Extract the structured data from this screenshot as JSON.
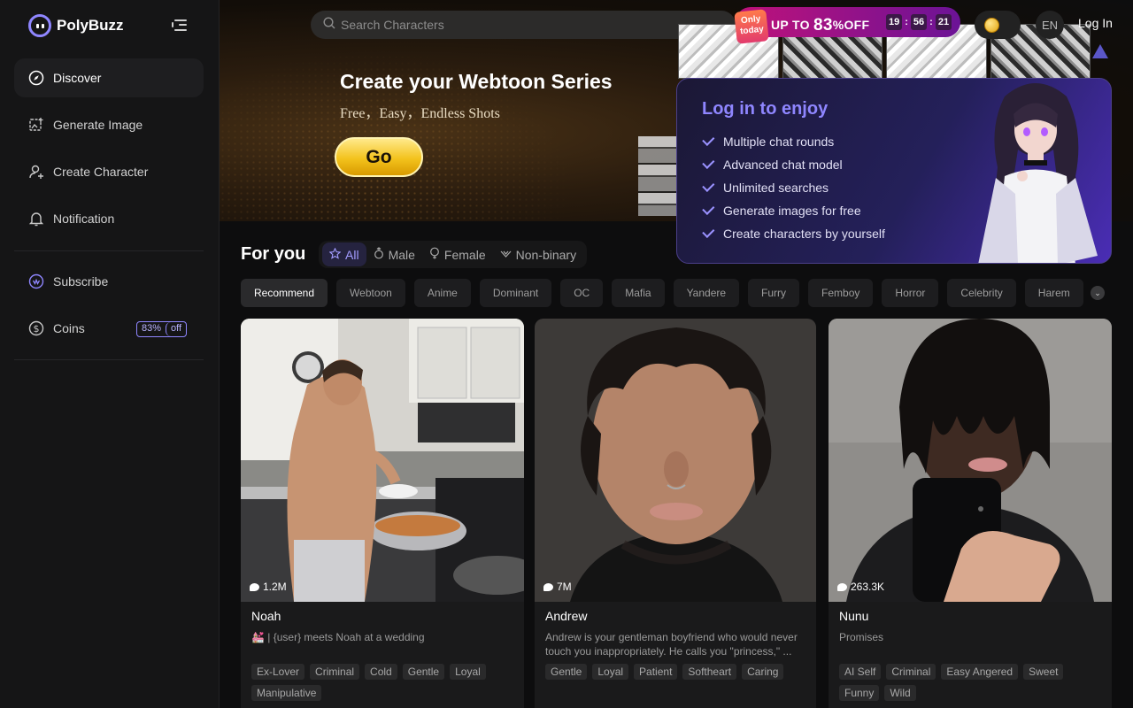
{
  "brand": {
    "name": "PolyBuzz",
    "accent": "#8f86ff"
  },
  "sidebar": {
    "items": [
      {
        "label": "Discover",
        "icon": "compass-icon",
        "active": true
      },
      {
        "label": "Generate Image",
        "icon": "image-plus-icon"
      },
      {
        "label": "Create Character",
        "icon": "user-plus-icon"
      },
      {
        "label": "Notification",
        "icon": "bell-icon"
      }
    ],
    "secondary": [
      {
        "label": "Subscribe",
        "icon": "crown-icon"
      },
      {
        "label": "Coins",
        "icon": "dollar-icon",
        "badge": [
          "83%",
          "off"
        ]
      }
    ]
  },
  "search": {
    "placeholder": "Search Characters"
  },
  "promo": {
    "tag": "Only today",
    "prefix": "UP TO",
    "percent": "83",
    "suffix": "%OFF",
    "timer": [
      "19",
      "56",
      "21"
    ]
  },
  "header": {
    "lang": "EN",
    "login": "Log In"
  },
  "hero": {
    "title": "Create your Webtoon Series",
    "subtitle": "Free，Easy，Endless Shots",
    "button": "Go"
  },
  "login_popup": {
    "title": "Log in to enjoy",
    "benefits": [
      "Multiple chat rounds",
      "Advanced chat model",
      "Unlimited searches",
      "Generate images for free",
      "Create characters by yourself"
    ]
  },
  "feed": {
    "heading": "For you",
    "gender_tabs": [
      {
        "label": "All",
        "icon": "star-icon",
        "active": true
      },
      {
        "label": "Male",
        "icon": "male-icon"
      },
      {
        "label": "Female",
        "icon": "female-icon"
      },
      {
        "label": "Non-binary",
        "icon": "nonbinary-icon"
      }
    ],
    "categories": [
      "Recommend",
      "Webtoon",
      "Anime",
      "Dominant",
      "OC",
      "Mafia",
      "Yandere",
      "Furry",
      "Femboy",
      "Horror",
      "Celebrity",
      "Harem"
    ],
    "cards": [
      {
        "name": "Noah",
        "chats": "1.2M",
        "desc": "💒 | {user} meets Noah at a wedding",
        "tags": [
          "Ex-Lover",
          "Criminal",
          "Cold",
          "Gentle",
          "Loyal",
          "Manipulative"
        ]
      },
      {
        "name": "Andrew",
        "chats": "7M",
        "desc": "Andrew is your gentleman boyfriend who would never touch you inappropriately. He calls you \"princess,\" ...",
        "tags": [
          "Gentle",
          "Loyal",
          "Patient",
          "Softheart",
          "Caring"
        ]
      },
      {
        "name": "Nunu",
        "chats": "263.3K",
        "desc": "Promises",
        "tags": [
          "AI Self",
          "Criminal",
          "Easy Angered",
          "Sweet",
          "Funny",
          "Wild"
        ]
      }
    ]
  }
}
